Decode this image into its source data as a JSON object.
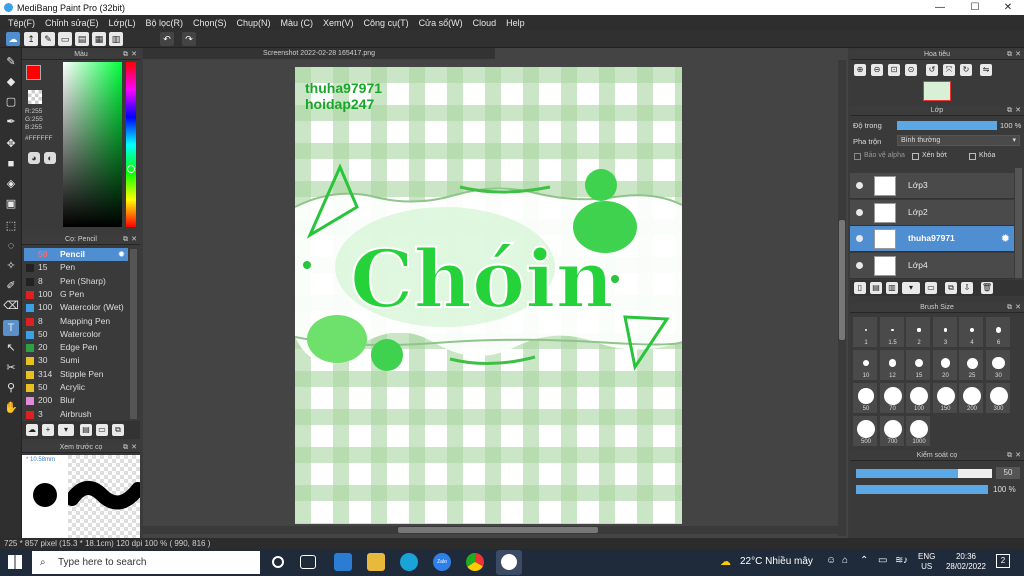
{
  "window": {
    "title": "MediBang Paint Pro (32bit)",
    "minimize": "—",
    "maximize": "☐",
    "close": "✕"
  },
  "menu": [
    "Tệp(F)",
    "Chỉnh sửa(E)",
    "Lớp(L)",
    "Bộ lọc(R)",
    "Chọn(S)",
    "Chụp(N)",
    "Màu (C)",
    "Xem(V)",
    "Công cụ(T)",
    "Cửa sổ(W)",
    "Cloud",
    "Help"
  ],
  "color_panel": {
    "title": "Màu",
    "primary": "#FF0000",
    "secondary": "#FFFFFF",
    "r": "R:255",
    "g": "G:255",
    "b": "B:255",
    "hex": "#FFFFFF"
  },
  "brush_panel": {
    "title": "Cọ: Pencil",
    "items": [
      {
        "size": "50",
        "name": "Pencil",
        "color": "#4f8ed0",
        "selected": true
      },
      {
        "size": "15",
        "name": "Pen",
        "color": "#222222"
      },
      {
        "size": "8",
        "name": "Pen (Sharp)",
        "color": "#222222"
      },
      {
        "size": "100",
        "name": "G Pen",
        "color": "#e02020"
      },
      {
        "size": "100",
        "name": "Watercolor (Wet)",
        "color": "#3aa0e8"
      },
      {
        "size": "8",
        "name": "Mapping Pen",
        "color": "#e02020"
      },
      {
        "size": "50",
        "name": "Watercolor",
        "color": "#3aa0e8"
      },
      {
        "size": "20",
        "name": "Edge Pen",
        "color": "#2ea043"
      },
      {
        "size": "30",
        "name": "Sumi",
        "color": "#e8c020"
      },
      {
        "size": "314",
        "name": "Stipple Pen",
        "color": "#e8c020"
      },
      {
        "size": "50",
        "name": "Acrylic",
        "color": "#e8c020"
      },
      {
        "size": "200",
        "name": "Blur",
        "color": "#e08ad8"
      },
      {
        "size": "3",
        "name": "Airbrush",
        "color": "#e02020"
      }
    ]
  },
  "preview_panel": {
    "title": "Xem trước cọ",
    "size": "* 10.58mm"
  },
  "document": {
    "tab": "Screenshot 2022-02-28 165417.png",
    "watermark1": "thuha97971",
    "watermark2": "hoidap247",
    "art_text": "Chóin"
  },
  "status": {
    "text": "725 * 857 pixel   (15.3 * 18.1cm)   120 dpi   100 %   ( 990, 816 )"
  },
  "navigator": {
    "title": "Hoa tiêu"
  },
  "layers": {
    "title": "Lớp",
    "opacity_label": "Độ trong",
    "opacity_value": "100 %",
    "opacity_fraction": 1.0,
    "blend_label": "Pha trộn",
    "blend_value": "Bình thường",
    "protect_alpha": "Bảo vệ alpha",
    "clipping": "Xén bớt",
    "lock": "Khóa",
    "items": [
      {
        "name": "Lớp3",
        "selected": false
      },
      {
        "name": "Lớp2",
        "selected": false
      },
      {
        "name": "thuha97971",
        "selected": true
      },
      {
        "name": "Lớp4",
        "selected": false
      }
    ]
  },
  "brush_size": {
    "title": "Brush Size",
    "sizes": [
      "1",
      "1.5",
      "2",
      "3",
      "4",
      "6",
      "10",
      "12",
      "15",
      "20",
      "25",
      "30",
      "50",
      "70",
      "100",
      "150",
      "200",
      "300",
      "500",
      "700",
      "1000"
    ]
  },
  "brush_control": {
    "title": "Kiểm soát cọ",
    "size_value": "50",
    "size_fraction": 0.75,
    "opacity_value": "100 %",
    "opacity_fraction": 1.0
  },
  "taskbar": {
    "search_placeholder": "Type here to search",
    "weather": "22°C  Nhiều mây",
    "lang1": "ENG",
    "lang2": "US",
    "time": "20:36",
    "date": "28/02/2022",
    "notif": "2"
  }
}
